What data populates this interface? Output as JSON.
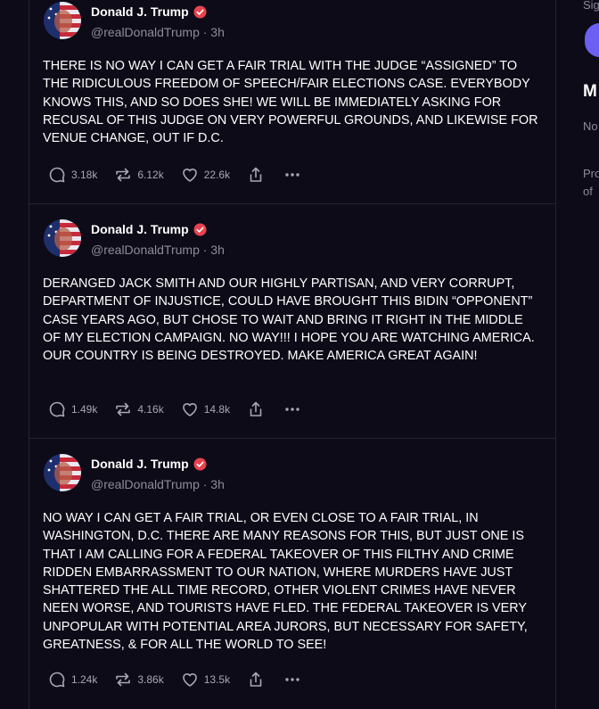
{
  "posts": [
    {
      "author": "Donald J. Trump",
      "handle": "@realDonaldTrump · 3h",
      "text": "THERE IS NO WAY I CAN GET A FAIR TRIAL WITH THE JUDGE “ASSIGNED” TO THE RIDICULOUS FREEDOM OF SPEECH/FAIR ELECTIONS CASE. EVERYBODY KNOWS THIS, AND SO DOES SHE! WE WILL BE IMMEDIATELY ASKING FOR RECUSAL OF THIS JUDGE ON VERY POWERFUL GROUNDS, AND LIKEWISE FOR VENUE CHANGE, OUT IF D.C.",
      "replies": "3.18k",
      "retruths": "6.12k",
      "likes": "22.6k"
    },
    {
      "author": "Donald J. Trump",
      "handle": "@realDonaldTrump · 3h",
      "text": "DERANGED JACK SMITH AND OUR HIGHLY PARTISAN, AND VERY CORRUPT, DEPARTMENT OF INJUSTICE, COULD HAVE BROUGHT THIS BIDIN “OPPONENT” CASE YEARS AGO, BUT CHOSE TO WAIT AND BRING IT RIGHT IN THE MIDDLE OF MY ELECTION CAMPAIGN. NO WAY!!! I HOPE YOU ARE WATCHING AMERICA. OUR COUNTRY IS BEING DESTROYED. MAKE AMERICA GREAT AGAIN!",
      "replies": "1.49k",
      "retruths": "4.16k",
      "likes": "14.8k"
    },
    {
      "author": "Donald J. Trump",
      "handle": "@realDonaldTrump · 3h",
      "text": "NO WAY I CAN GET A FAIR TRIAL, OR EVEN CLOSE TO A FAIR TRIAL, IN WASHINGTON, D.C. THERE ARE MANY REASONS FOR THIS, BUT JUST ONE IS THAT I AM CALLING FOR A FEDERAL TAKEOVER OF THIS FILTHY AND CRIME RIDDEN EMBARRASSMENT TO OUR NATION,  WHERE MURDERS HAVE JUST SHATTERED THE ALL TIME RECORD, OTHER VIOLENT CRIMES HAVE NEVER NEEN WORSE, AND TOURISTS HAVE FLED. THE FEDERAL TAKEOVER IS VERY UNPOPULAR WITH POTENTIAL AREA JURORS, BUT NECESSARY FOR SAFETY, GREATNESS, & FOR ALL THE WORLD TO SEE!",
      "replies": "1.24k",
      "retruths": "3.86k",
      "likes": "13.5k"
    }
  ],
  "sidebar": {
    "line1": "Sig",
    "heading": "M",
    "line2": "No",
    "line3a": "Pro",
    "line3b": "of"
  },
  "colors": {
    "background": "#0c0b17",
    "verified_badge": "#e8424f",
    "accent_button": "#6d5ff2",
    "secondary_text": "#8d8c99"
  },
  "icons": [
    "reply-icon",
    "retruth-icon",
    "like-icon",
    "share-icon",
    "more-icon",
    "verified-icon"
  ]
}
